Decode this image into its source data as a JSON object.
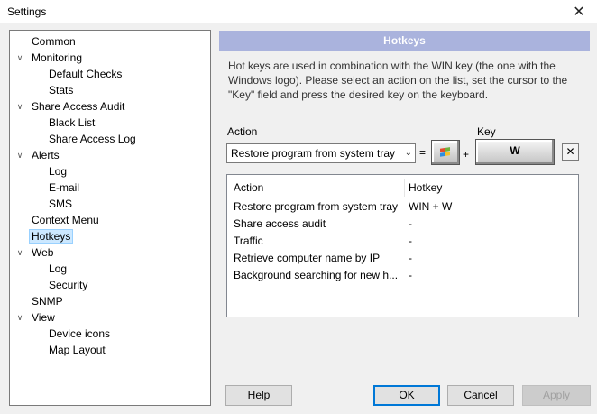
{
  "window": {
    "title": "Settings"
  },
  "tree": [
    {
      "label": "Common",
      "level": 0,
      "expander": false
    },
    {
      "label": "Monitoring",
      "level": 0,
      "expander": true
    },
    {
      "label": "Default Checks",
      "level": 1,
      "expander": false
    },
    {
      "label": "Stats",
      "level": 1,
      "expander": false
    },
    {
      "label": "Share Access Audit",
      "level": 0,
      "expander": true
    },
    {
      "label": "Black List",
      "level": 1,
      "expander": false
    },
    {
      "label": "Share Access Log",
      "level": 1,
      "expander": false
    },
    {
      "label": "Alerts",
      "level": 0,
      "expander": true
    },
    {
      "label": "Log",
      "level": 1,
      "expander": false
    },
    {
      "label": "E-mail",
      "level": 1,
      "expander": false
    },
    {
      "label": "SMS",
      "level": 1,
      "expander": false
    },
    {
      "label": "Context Menu",
      "level": 0,
      "expander": false
    },
    {
      "label": "Hotkeys",
      "level": 0,
      "expander": false,
      "selected": true
    },
    {
      "label": "Web",
      "level": 0,
      "expander": true
    },
    {
      "label": "Log",
      "level": 1,
      "expander": false
    },
    {
      "label": "Security",
      "level": 1,
      "expander": false
    },
    {
      "label": "SNMP",
      "level": 0,
      "expander": false
    },
    {
      "label": "View",
      "level": 0,
      "expander": true
    },
    {
      "label": "Device icons",
      "level": 1,
      "expander": false
    },
    {
      "label": "Map Layout",
      "level": 1,
      "expander": false
    }
  ],
  "panel": {
    "header": "Hotkeys",
    "description": "Hot keys are used in combination with the WIN key (the one with the Windows logo). Please select an action on the list, set the cursor to the \"Key\" field and press the desired key on the keyboard.",
    "action_label": "Action",
    "key_label": "Key",
    "selected_action": "Restore program from system tray",
    "equals": "=",
    "plus": "+",
    "key_value": "W",
    "clear_label": "✕"
  },
  "list": {
    "columns": [
      "Action",
      "Hotkey"
    ],
    "rows": [
      {
        "action": "Restore program from system tray",
        "hotkey": "WIN + W"
      },
      {
        "action": "Share access audit",
        "hotkey": "-"
      },
      {
        "action": "Traffic",
        "hotkey": "-"
      },
      {
        "action": "Retrieve computer name by IP",
        "hotkey": "-"
      },
      {
        "action": "Background searching for new h...",
        "hotkey": "-"
      }
    ]
  },
  "buttons": {
    "help": "Help",
    "ok": "OK",
    "cancel": "Cancel",
    "apply": "Apply"
  },
  "colors": {
    "header_bg": "#aab3dd",
    "selection": "#cce8ff",
    "focus": "#0078d7"
  }
}
